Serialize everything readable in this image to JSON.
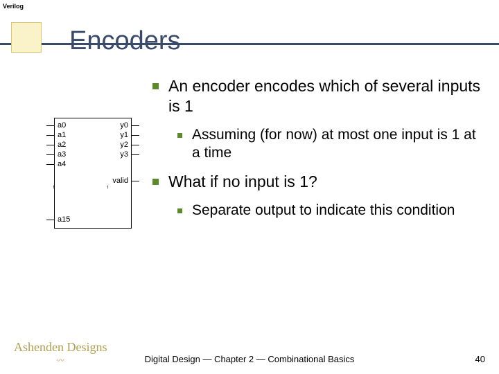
{
  "brand": "Verilog",
  "title": "Encoders",
  "bullets": {
    "l1a": "An encoder encodes which of several inputs is 1",
    "l2a": "Assuming (for now) at most one input is 1 at a time",
    "l1b": "What if no input is 1?",
    "l2b": "Separate output to indicate this condition"
  },
  "figure": {
    "inputs": [
      "a0",
      "a1",
      "a2",
      "a3",
      "a4",
      "a15"
    ],
    "outputs": [
      "y0",
      "y1",
      "y2",
      "y3",
      "valid"
    ]
  },
  "footer": "Digital Design — Chapter 2 — Combinational Basics",
  "page": "40",
  "logo": "Ashenden Designs"
}
